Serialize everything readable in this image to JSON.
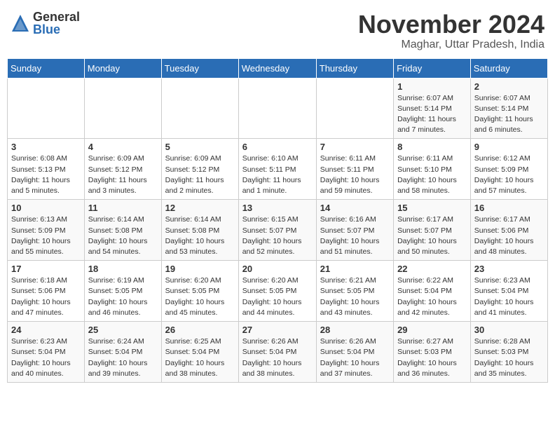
{
  "header": {
    "logo_general": "General",
    "logo_blue": "Blue",
    "month_title": "November 2024",
    "location": "Maghar, Uttar Pradesh, India"
  },
  "weekdays": [
    "Sunday",
    "Monday",
    "Tuesday",
    "Wednesday",
    "Thursday",
    "Friday",
    "Saturday"
  ],
  "weeks": [
    [
      {
        "day": "",
        "info": ""
      },
      {
        "day": "",
        "info": ""
      },
      {
        "day": "",
        "info": ""
      },
      {
        "day": "",
        "info": ""
      },
      {
        "day": "",
        "info": ""
      },
      {
        "day": "1",
        "info": "Sunrise: 6:07 AM\nSunset: 5:14 PM\nDaylight: 11 hours and 7 minutes."
      },
      {
        "day": "2",
        "info": "Sunrise: 6:07 AM\nSunset: 5:14 PM\nDaylight: 11 hours and 6 minutes."
      }
    ],
    [
      {
        "day": "3",
        "info": "Sunrise: 6:08 AM\nSunset: 5:13 PM\nDaylight: 11 hours and 5 minutes."
      },
      {
        "day": "4",
        "info": "Sunrise: 6:09 AM\nSunset: 5:12 PM\nDaylight: 11 hours and 3 minutes."
      },
      {
        "day": "5",
        "info": "Sunrise: 6:09 AM\nSunset: 5:12 PM\nDaylight: 11 hours and 2 minutes."
      },
      {
        "day": "6",
        "info": "Sunrise: 6:10 AM\nSunset: 5:11 PM\nDaylight: 11 hours and 1 minute."
      },
      {
        "day": "7",
        "info": "Sunrise: 6:11 AM\nSunset: 5:11 PM\nDaylight: 10 hours and 59 minutes."
      },
      {
        "day": "8",
        "info": "Sunrise: 6:11 AM\nSunset: 5:10 PM\nDaylight: 10 hours and 58 minutes."
      },
      {
        "day": "9",
        "info": "Sunrise: 6:12 AM\nSunset: 5:09 PM\nDaylight: 10 hours and 57 minutes."
      }
    ],
    [
      {
        "day": "10",
        "info": "Sunrise: 6:13 AM\nSunset: 5:09 PM\nDaylight: 10 hours and 55 minutes."
      },
      {
        "day": "11",
        "info": "Sunrise: 6:14 AM\nSunset: 5:08 PM\nDaylight: 10 hours and 54 minutes."
      },
      {
        "day": "12",
        "info": "Sunrise: 6:14 AM\nSunset: 5:08 PM\nDaylight: 10 hours and 53 minutes."
      },
      {
        "day": "13",
        "info": "Sunrise: 6:15 AM\nSunset: 5:07 PM\nDaylight: 10 hours and 52 minutes."
      },
      {
        "day": "14",
        "info": "Sunrise: 6:16 AM\nSunset: 5:07 PM\nDaylight: 10 hours and 51 minutes."
      },
      {
        "day": "15",
        "info": "Sunrise: 6:17 AM\nSunset: 5:07 PM\nDaylight: 10 hours and 50 minutes."
      },
      {
        "day": "16",
        "info": "Sunrise: 6:17 AM\nSunset: 5:06 PM\nDaylight: 10 hours and 48 minutes."
      }
    ],
    [
      {
        "day": "17",
        "info": "Sunrise: 6:18 AM\nSunset: 5:06 PM\nDaylight: 10 hours and 47 minutes."
      },
      {
        "day": "18",
        "info": "Sunrise: 6:19 AM\nSunset: 5:05 PM\nDaylight: 10 hours and 46 minutes."
      },
      {
        "day": "19",
        "info": "Sunrise: 6:20 AM\nSunset: 5:05 PM\nDaylight: 10 hours and 45 minutes."
      },
      {
        "day": "20",
        "info": "Sunrise: 6:20 AM\nSunset: 5:05 PM\nDaylight: 10 hours and 44 minutes."
      },
      {
        "day": "21",
        "info": "Sunrise: 6:21 AM\nSunset: 5:05 PM\nDaylight: 10 hours and 43 minutes."
      },
      {
        "day": "22",
        "info": "Sunrise: 6:22 AM\nSunset: 5:04 PM\nDaylight: 10 hours and 42 minutes."
      },
      {
        "day": "23",
        "info": "Sunrise: 6:23 AM\nSunset: 5:04 PM\nDaylight: 10 hours and 41 minutes."
      }
    ],
    [
      {
        "day": "24",
        "info": "Sunrise: 6:23 AM\nSunset: 5:04 PM\nDaylight: 10 hours and 40 minutes."
      },
      {
        "day": "25",
        "info": "Sunrise: 6:24 AM\nSunset: 5:04 PM\nDaylight: 10 hours and 39 minutes."
      },
      {
        "day": "26",
        "info": "Sunrise: 6:25 AM\nSunset: 5:04 PM\nDaylight: 10 hours and 38 minutes."
      },
      {
        "day": "27",
        "info": "Sunrise: 6:26 AM\nSunset: 5:04 PM\nDaylight: 10 hours and 38 minutes."
      },
      {
        "day": "28",
        "info": "Sunrise: 6:26 AM\nSunset: 5:04 PM\nDaylight: 10 hours and 37 minutes."
      },
      {
        "day": "29",
        "info": "Sunrise: 6:27 AM\nSunset: 5:03 PM\nDaylight: 10 hours and 36 minutes."
      },
      {
        "day": "30",
        "info": "Sunrise: 6:28 AM\nSunset: 5:03 PM\nDaylight: 10 hours and 35 minutes."
      }
    ]
  ]
}
